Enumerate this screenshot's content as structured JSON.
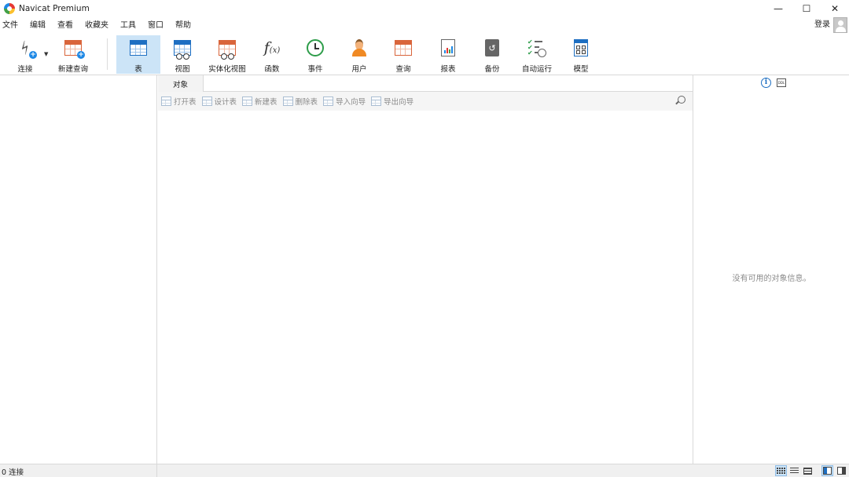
{
  "window": {
    "title": "Navicat Premium",
    "controls": {
      "minimize": "—",
      "maximize": "☐",
      "close": "✕"
    }
  },
  "menu": {
    "items": [
      "文件",
      "编辑",
      "查看",
      "收藏夹",
      "工具",
      "窗口",
      "帮助"
    ],
    "login": "登录"
  },
  "toolbar": {
    "items": [
      {
        "label": "连接",
        "icon": "plug-icon"
      },
      {
        "label": "新建查询",
        "icon": "new-query-icon"
      },
      {
        "label": "表",
        "icon": "table-icon",
        "active": true
      },
      {
        "label": "视图",
        "icon": "view-icon"
      },
      {
        "label": "实体化视图",
        "icon": "materialized-view-icon"
      },
      {
        "label": "函数",
        "icon": "function-icon"
      },
      {
        "label": "事件",
        "icon": "event-clock-icon"
      },
      {
        "label": "用户",
        "icon": "user-icon"
      },
      {
        "label": "查询",
        "icon": "query-icon"
      },
      {
        "label": "报表",
        "icon": "report-icon"
      },
      {
        "label": "备份",
        "icon": "backup-icon"
      },
      {
        "label": "自动运行",
        "icon": "automation-icon"
      },
      {
        "label": "模型",
        "icon": "model-icon"
      }
    ],
    "function_glyph": "f",
    "function_sub": "(x)"
  },
  "objects": {
    "tab_label": "对象",
    "actions": [
      "打开表",
      "设计表",
      "新建表",
      "删除表",
      "导入向导",
      "导出向导"
    ]
  },
  "info_panel": {
    "info_glyph": "i",
    "ddl_glyph": "DDL",
    "empty_text": "没有可用的对象信息。"
  },
  "status": {
    "connections": "0 连接"
  },
  "colors": {
    "accent": "#1e6fc2",
    "active_tab_bg": "#cce4f7",
    "disabled_text": "#8a8a8a"
  }
}
